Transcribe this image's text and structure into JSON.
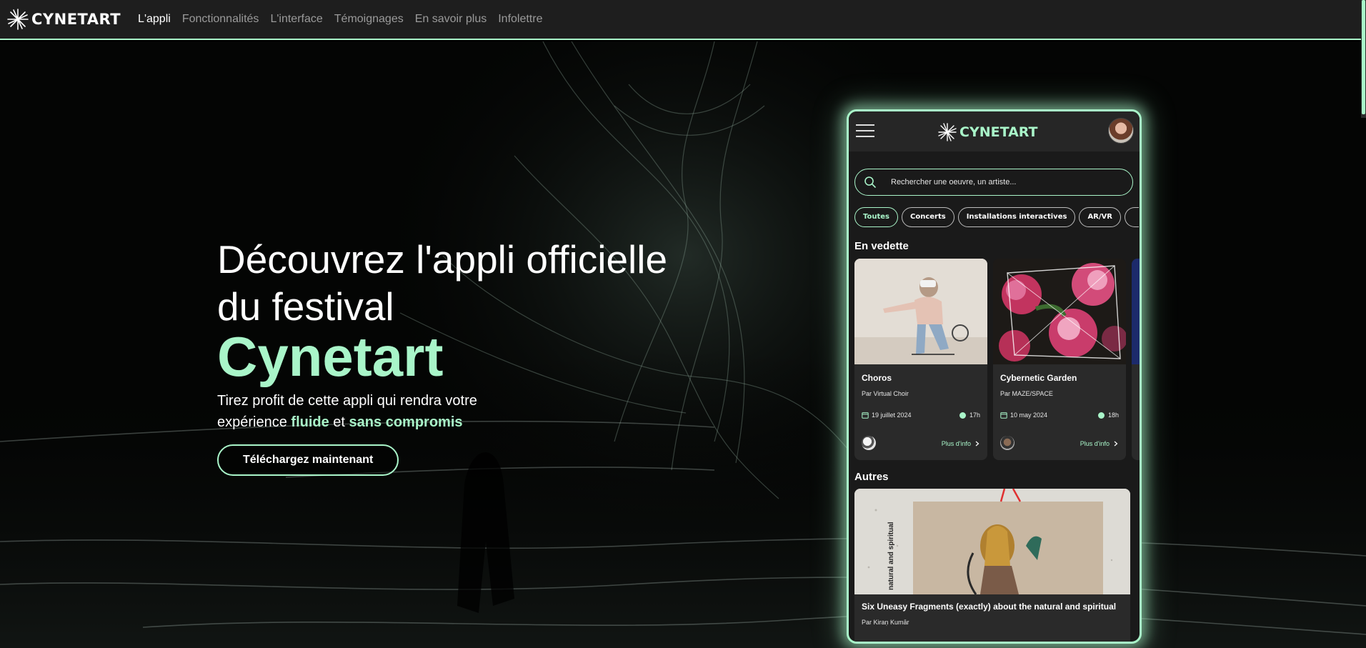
{
  "brand": {
    "name": "CYNETART",
    "logo_icon": "starburst-icon",
    "accent_color": "#a9f5c9"
  },
  "nav": {
    "items": [
      {
        "label": "L'appli",
        "active": true
      },
      {
        "label": "Fonctionnalités",
        "active": false
      },
      {
        "label": "L'interface",
        "active": false
      },
      {
        "label": "Témoignages",
        "active": false
      },
      {
        "label": "En savoir plus",
        "active": false
      },
      {
        "label": "Infolettre",
        "active": false
      }
    ]
  },
  "hero": {
    "title_line1": "Découvrez l'appli officielle",
    "title_line2": "du festival",
    "title_brand": "Cynetart",
    "subtitle_part1": "Tirez profit de cette appli qui rendra votre expérience ",
    "subtitle_accent1": "fluide",
    "subtitle_mid": " et ",
    "subtitle_accent2": "sans compromis",
    "cta_label": "Téléchargez maintenant"
  },
  "phone": {
    "logo_text": "CYNETART",
    "menu_icon": "hamburger-icon",
    "search": {
      "placeholder": "Rechercher une oeuvre, un artiste...",
      "icon": "search-icon"
    },
    "filters": [
      {
        "label": "Toutes",
        "active": true
      },
      {
        "label": "Concerts",
        "active": false
      },
      {
        "label": "Installations interactives",
        "active": false
      },
      {
        "label": "AR/VR",
        "active": false
      }
    ],
    "featured_title": "En vedette",
    "featured": [
      {
        "title": "Choros",
        "author": "Par Virtual Choir",
        "date": "19 juillet 2024",
        "time": "17h",
        "more": "Plus d'info"
      },
      {
        "title": "Cybernetic Garden",
        "author": "Par MAZE/SPACE",
        "date": "10 may 2024",
        "time": "18h",
        "more": "Plus d'info"
      }
    ],
    "others_title": "Autres",
    "others": [
      {
        "title": "Six Uneasy Fragments (exactly) about the natural and spiritual",
        "author": "Par Kiraṇ Kumār",
        "image_text": "natural and spiritual"
      }
    ]
  }
}
